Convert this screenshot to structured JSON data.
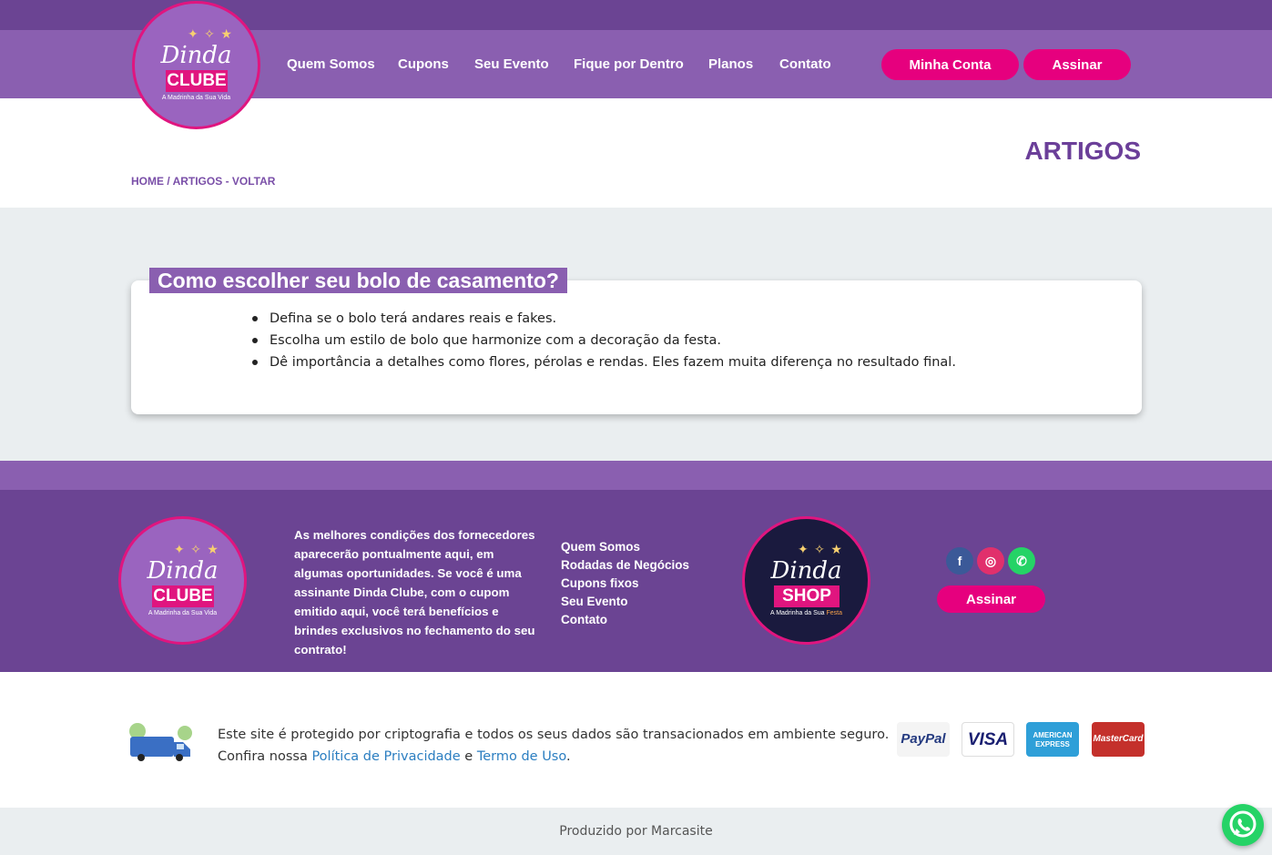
{
  "header": {
    "logo": {
      "script": "Dinda",
      "box": "CLUBE",
      "tagline": "A Madrinha da Sua Vida"
    },
    "nav": [
      {
        "label": "Quem Somos"
      },
      {
        "label": "Cupons"
      },
      {
        "label": "Seu Evento"
      },
      {
        "label": "Fique por Dentro"
      },
      {
        "label": "Planos"
      },
      {
        "label": "Contato"
      }
    ],
    "account_button": "Minha Conta",
    "subscribe_button": "Assinar"
  },
  "page": {
    "title": "ARTIGOS",
    "breadcrumb": {
      "home": "HOME",
      "sep": " / ",
      "current": "ARTIGOS",
      "back": " - VOLTAR"
    }
  },
  "article": {
    "title": "Como escolher seu bolo de casamento?",
    "items": [
      "Defina se o bolo terá andares reais e fakes.",
      "Escolha um estilo de bolo que harmonize com a decoração da festa.",
      "Dê importância a detalhes como flores, pérolas e rendas. Eles fazem muita diferença no resultado final."
    ]
  },
  "footer": {
    "logo": {
      "script": "Dinda",
      "box": "CLUBE",
      "tagline": "A Madrinha da Sua Vida"
    },
    "text": "As melhores condições dos fornecedores aparecerão pontualmente aqui, em algumas oportunidades. Se você é uma assinante Dinda Clube, com o cupom emitido aqui, você terá benefícios e brindes exclusivos no fechamento do seu contrato!",
    "links": [
      "Quem Somos",
      "Rodadas de Negócios",
      "Cupons fixos",
      "Seu Evento",
      "Contato"
    ],
    "shop_logo": {
      "script": "Dinda",
      "box": "SHOP",
      "tagline_a": "A Madrinha da Sua ",
      "tagline_b": "Festa"
    },
    "subscribe_button": "Assinar",
    "social": {
      "facebook": "f",
      "instagram": "◎",
      "whatsapp": "✆"
    }
  },
  "security": {
    "line1": "Este site é protegido por criptografia e todos os seus dados são transacionados em ambiente seguro.",
    "line2_prefix": "Confira nossa ",
    "privacy_link": "Política de Privacidade",
    "line2_mid": " e ",
    "terms_link": "Termo de Uso",
    "line2_suffix": ".",
    "payments": {
      "paypal": "PayPal",
      "visa": "VISA",
      "amex": "AMERICAN EXPRESS",
      "mastercard": "MasterCard"
    }
  },
  "bottom": {
    "produced": "Produzido por Marcasite"
  },
  "colors": {
    "purple_dark": "#6b4493",
    "purple": "#8a5fb0",
    "pink": "#e6007e",
    "link_blue": "#2b7ec1"
  }
}
